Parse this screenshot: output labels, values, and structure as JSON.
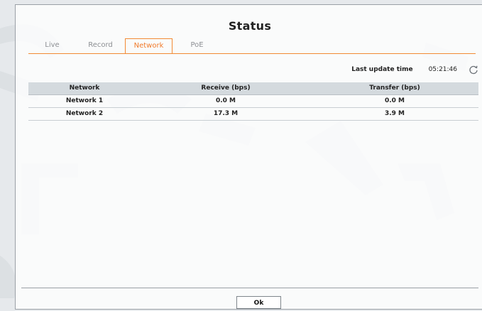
{
  "dialog": {
    "title": "Status"
  },
  "tabs": [
    {
      "label": "Live"
    },
    {
      "label": "Record"
    },
    {
      "label": "Network",
      "active": true
    },
    {
      "label": "PoE"
    }
  ],
  "update": {
    "label": "Last update time",
    "time": "05:21:46",
    "icon": "refresh-icon"
  },
  "table": {
    "headers": {
      "network": "Network",
      "receive": "Receive (bps)",
      "transfer": "Transfer (bps)"
    },
    "rows": [
      {
        "network": "Network 1",
        "receive": "0.0 M",
        "transfer": "0.0 M"
      },
      {
        "network": "Network 2",
        "receive": "17.3 M",
        "transfer": "3.9 M"
      }
    ]
  },
  "footer": {
    "ok_label": "Ok"
  },
  "colors": {
    "accent": "#f07b2b",
    "header_bg": "#d4dade"
  }
}
